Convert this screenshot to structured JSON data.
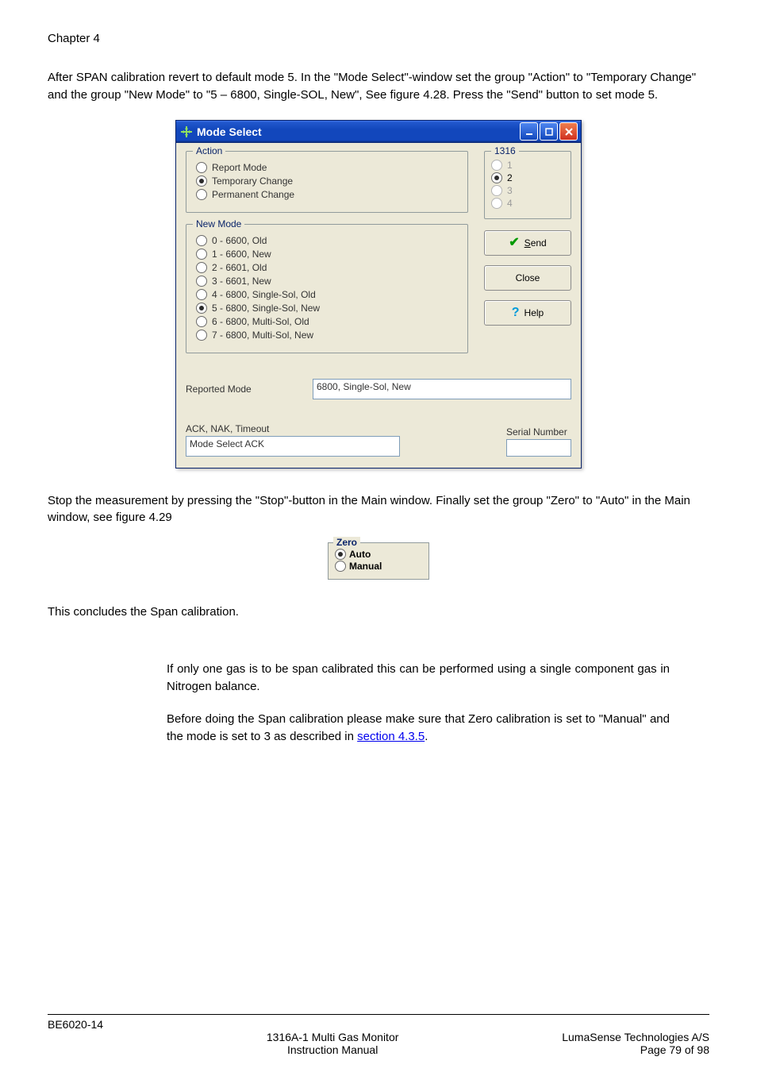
{
  "chapter_title": "Chapter 4",
  "paragraphs": {
    "p1": "After SPAN calibration revert to default mode 5. In the \"Mode Select\"-window set the group \"Action\" to \"Temporary Change\" and the group \"New Mode\" to \"5 – 6800, Single-SOL, New\", See figure 4.28. Press the \"Send\" button to set mode 5.",
    "p2": "Stop the measurement by pressing the \"Stop\"-button in the Main window. Finally set the group \"Zero\" to \"Auto\" in the Main window, see figure 4.29",
    "p3": "This concludes the Span calibration.",
    "p4": "If only one gas is to be span calibrated this can be performed using a single component gas in Nitrogen balance.",
    "p5a": "Before doing the Span calibration please make sure that Zero calibration is set to \"Manual\" and the mode is set to 3 as described in ",
    "p5_link": "section 4.3.5",
    "p5b": "."
  },
  "mode_select": {
    "title": "Mode Select",
    "action": {
      "legend": "Action",
      "options": [
        {
          "label": "Report Mode",
          "checked": false
        },
        {
          "label": "Temporary Change",
          "checked": true
        },
        {
          "label": "Permanent Change",
          "checked": false
        }
      ]
    },
    "new_mode": {
      "legend": "New Mode",
      "options": [
        {
          "label": "0 - 6600, Old",
          "checked": false
        },
        {
          "label": "1 - 6600, New",
          "checked": false
        },
        {
          "label": "2 - 6601, Old",
          "checked": false
        },
        {
          "label": "3 - 6601, New",
          "checked": false
        },
        {
          "label": "4 - 6800, Single-Sol, Old",
          "checked": false
        },
        {
          "label": "5 - 6800, Single-Sol, New",
          "checked": true
        },
        {
          "label": "6 - 6800, Multi-Sol, Old",
          "checked": false
        },
        {
          "label": "7 - 6800, Multi-Sol, New",
          "checked": false
        }
      ]
    },
    "unit": {
      "legend": "1316",
      "options": [
        {
          "label": "1",
          "checked": false,
          "disabled": true
        },
        {
          "label": "2",
          "checked": true,
          "disabled": false
        },
        {
          "label": "3",
          "checked": false,
          "disabled": true
        },
        {
          "label": "4",
          "checked": false,
          "disabled": true
        }
      ]
    },
    "buttons": {
      "send": "Send",
      "close": "Close",
      "help": "Help"
    },
    "reported_mode": {
      "label": "Reported Mode",
      "value": "6800, Single-Sol, New"
    },
    "ack": {
      "label": "ACK, NAK, Timeout",
      "value": "Mode Select  ACK"
    },
    "serial": {
      "label": "Serial Number",
      "value": ""
    }
  },
  "zero_group": {
    "legend": "Zero",
    "options": [
      {
        "label": "Auto",
        "checked": true
      },
      {
        "label": "Manual",
        "checked": false
      }
    ]
  },
  "footer": {
    "left": "BE6020-14",
    "center_l1": "1316A-1 Multi Gas Monitor",
    "center_l2": "Instruction Manual",
    "right_l1": "LumaSense Technologies A/S",
    "right_l2": "Page 79 of 98"
  }
}
